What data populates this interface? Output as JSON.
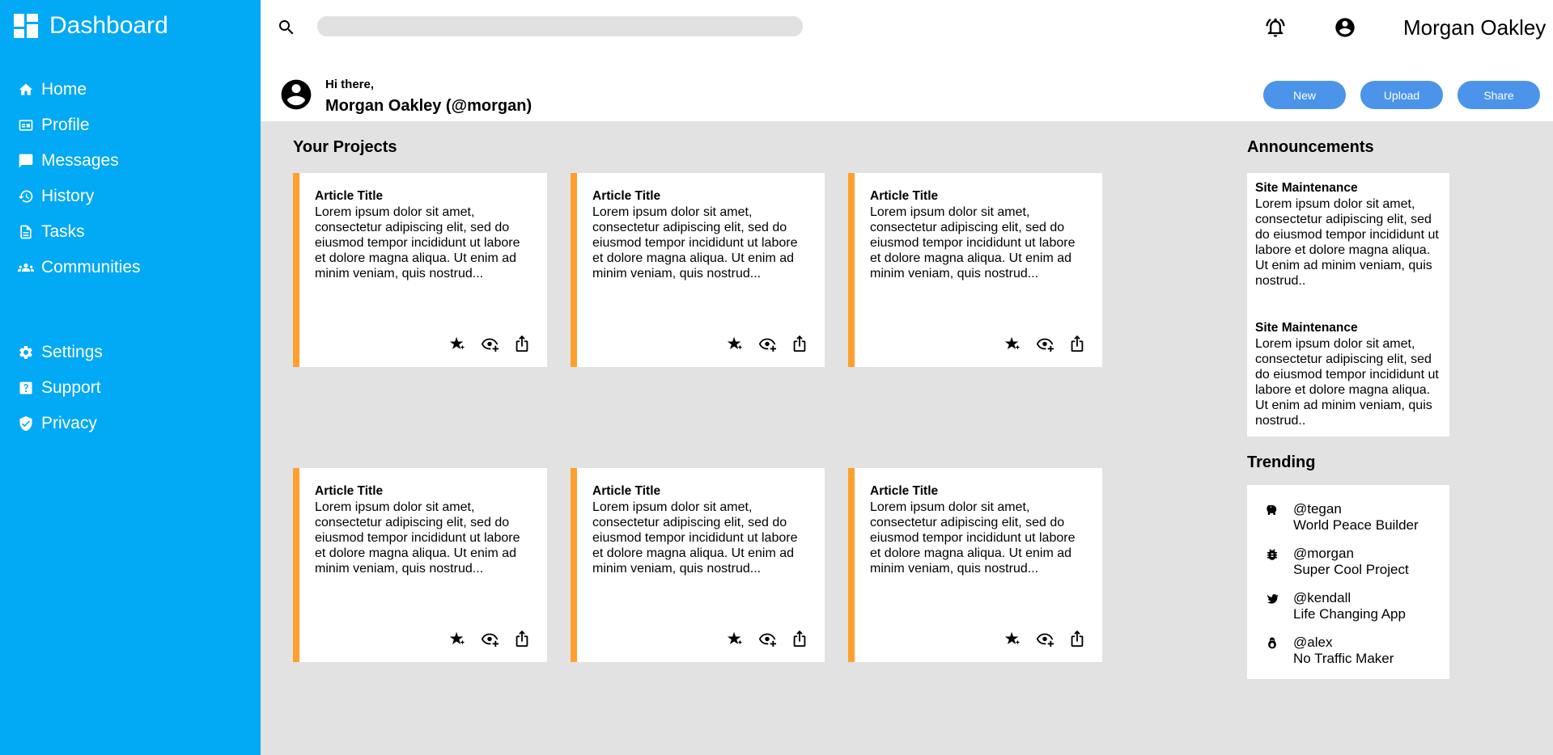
{
  "sidebar": {
    "brand": "Dashboard",
    "items": [
      {
        "label": "Home",
        "icon": "home-icon"
      },
      {
        "label": "Profile",
        "icon": "profile-card-icon"
      },
      {
        "label": "Messages",
        "icon": "message-icon"
      },
      {
        "label": "History",
        "icon": "history-icon"
      },
      {
        "label": "Tasks",
        "icon": "tasks-icon"
      },
      {
        "label": "Communities",
        "icon": "people-icon"
      }
    ],
    "settings_items": [
      {
        "label": "Settings",
        "icon": "gear-icon"
      },
      {
        "label": "Support",
        "icon": "help-icon"
      },
      {
        "label": "Privacy",
        "icon": "shield-icon"
      }
    ]
  },
  "header": {
    "search_placeholder": "",
    "user_name": "Morgan Oakley",
    "greeting": "Hi there,",
    "handle": "Morgan Oakley (@morgan)",
    "buttons": {
      "new": "New",
      "upload": "Upload",
      "share": "Share"
    }
  },
  "projects": {
    "title": "Your Projects",
    "cards": [
      {
        "title": "Article Title",
        "body": "Lorem ipsum dolor sit amet, consectetur adipiscing elit, sed do eiusmod tempor incididunt ut labore et dolore magna aliqua. Ut enim ad minim veniam, quis nostrud..."
      },
      {
        "title": "Article Title",
        "body": "Lorem ipsum dolor sit amet, consectetur adipiscing elit, sed do eiusmod tempor incididunt ut labore et dolore magna aliqua. Ut enim ad minim veniam, quis nostrud..."
      },
      {
        "title": "Article Title",
        "body": "Lorem ipsum dolor sit amet, consectetur adipiscing elit, sed do eiusmod tempor incididunt ut labore et dolore magna aliqua. Ut enim ad minim veniam, quis nostrud..."
      },
      {
        "title": "Article Title",
        "body": "Lorem ipsum dolor sit amet, consectetur adipiscing elit, sed do eiusmod tempor incididunt ut labore et dolore magna aliqua. Ut enim ad minim veniam, quis nostrud..."
      },
      {
        "title": "Article Title",
        "body": "Lorem ipsum dolor sit amet, consectetur adipiscing elit, sed do eiusmod tempor incididunt ut labore et dolore magna aliqua. Ut enim ad minim veniam, quis nostrud..."
      },
      {
        "title": "Article Title",
        "body": "Lorem ipsum dolor sit amet, consectetur adipiscing elit, sed do eiusmod tempor incididunt ut labore et dolore magna aliqua. Ut enim ad minim veniam, quis nostrud..."
      }
    ]
  },
  "announcements": {
    "title": "Announcements",
    "items": [
      {
        "title": "Site Maintenance",
        "body": "Lorem ipsum dolor sit amet, consectetur adipiscing elit, sed do eiusmod tempor incididunt ut labore et dolore magna aliqua. Ut enim ad minim veniam, quis nostrud.."
      },
      {
        "title": "Site Maintenance",
        "body": "Lorem ipsum dolor sit amet, consectetur adipiscing elit, sed do eiusmod tempor incididunt ut labore et dolore magna aliqua. Ut enim ad minim veniam, quis nostrud.."
      }
    ]
  },
  "trending": {
    "title": "Trending",
    "items": [
      {
        "user": "@tegan",
        "project": "World Peace Builder",
        "icon": "elephant-icon"
      },
      {
        "user": "@morgan",
        "project": "Super Cool Project",
        "icon": "bug-icon"
      },
      {
        "user": "@kendall",
        "project": "Life Changing App",
        "icon": "bird-icon"
      },
      {
        "user": "@alex",
        "project": "No Traffic Maker",
        "icon": "penguin-icon"
      }
    ]
  },
  "colors": {
    "sidebar": "#02a9f4",
    "accent_button": "#4b94ea",
    "card_border": "#ff9f2e",
    "background": "#e2e2e2"
  }
}
